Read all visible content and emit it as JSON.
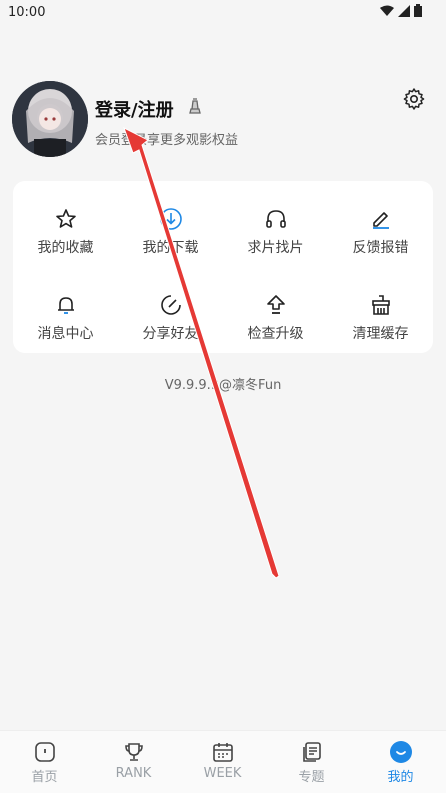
{
  "status_bar": {
    "time": "10:00"
  },
  "profile": {
    "login_title": "登录/注册",
    "subtitle": "会员登录享更多观影权益"
  },
  "grid": {
    "items": [
      {
        "label": "我的收藏",
        "icon": "star-icon"
      },
      {
        "label": "我的下载",
        "icon": "download-icon"
      },
      {
        "label": "求片找片",
        "icon": "headphones-icon"
      },
      {
        "label": "反馈报错",
        "icon": "edit-icon"
      },
      {
        "label": "消息中心",
        "icon": "bell-icon"
      },
      {
        "label": "分享好友",
        "icon": "share-icon"
      },
      {
        "label": "检查升级",
        "icon": "upgrade-icon"
      },
      {
        "label": "清理缓存",
        "icon": "clean-icon"
      }
    ]
  },
  "version": "V9.9.9.9@凛冬Fun",
  "bottom_nav": {
    "items": [
      {
        "label": "首页",
        "icon": "home-icon"
      },
      {
        "label": "RANK",
        "icon": "trophy-icon"
      },
      {
        "label": "WEEK",
        "icon": "calendar-icon"
      },
      {
        "label": "专题",
        "icon": "topics-icon"
      },
      {
        "label": "我的",
        "icon": "profile-icon",
        "active": true
      }
    ]
  },
  "colors": {
    "accent": "#1e88e5",
    "arrow": "#e53935"
  }
}
